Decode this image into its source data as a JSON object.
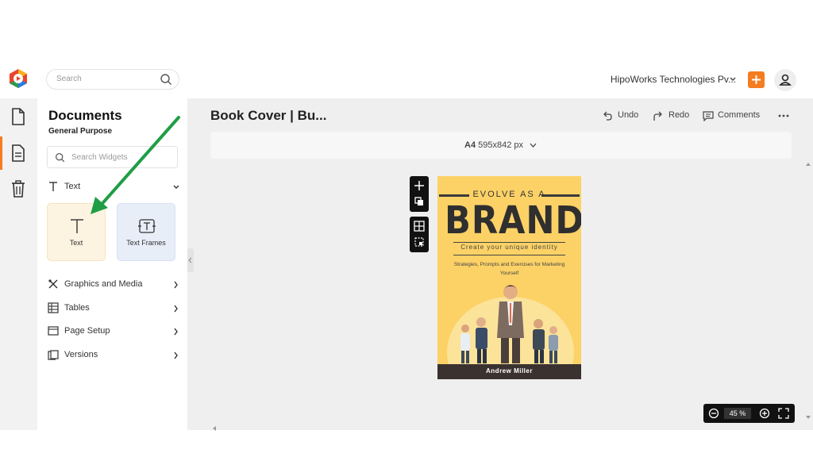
{
  "header": {
    "search_placeholder": "Search",
    "org_name": "HipoWorks Technologies Pv...",
    "accent_color": "#f57c20"
  },
  "rail": {
    "items": [
      {
        "name": "document-icon",
        "active": false
      },
      {
        "name": "documents-list-icon",
        "active": true
      },
      {
        "name": "trash-icon",
        "active": false
      }
    ]
  },
  "panel": {
    "title": "Documents",
    "subtitle": "General Purpose",
    "widget_search_placeholder": "Search Widgets",
    "text_section": "Text",
    "cards": [
      {
        "label": "Text",
        "icon": "text-t-icon"
      },
      {
        "label": "Text Frames",
        "icon": "text-frame-icon"
      }
    ],
    "sections": [
      {
        "label": "Graphics and Media",
        "icon": "graphics-icon"
      },
      {
        "label": "Tables",
        "icon": "table-icon"
      },
      {
        "label": "Page Setup",
        "icon": "page-setup-icon"
      },
      {
        "label": "Versions",
        "icon": "versions-icon"
      }
    ]
  },
  "main": {
    "doc_title": "Book Cover | Bu...",
    "toolbar": {
      "undo": "Undo",
      "redo": "Redo",
      "comments": "Comments"
    },
    "page_size_label": "A4",
    "page_size_value": "595x842 px",
    "zoom_value": "45",
    "zoom_unit": "%"
  },
  "cover": {
    "kicker": "EVOLVE AS A",
    "headline": "BRAND",
    "tagline": "Create your unique identity",
    "strapline": "Strategies, Prompts and Exercises for Marketing Yourself",
    "author": "Andrew Miller",
    "bg_color": "#fcd267"
  }
}
